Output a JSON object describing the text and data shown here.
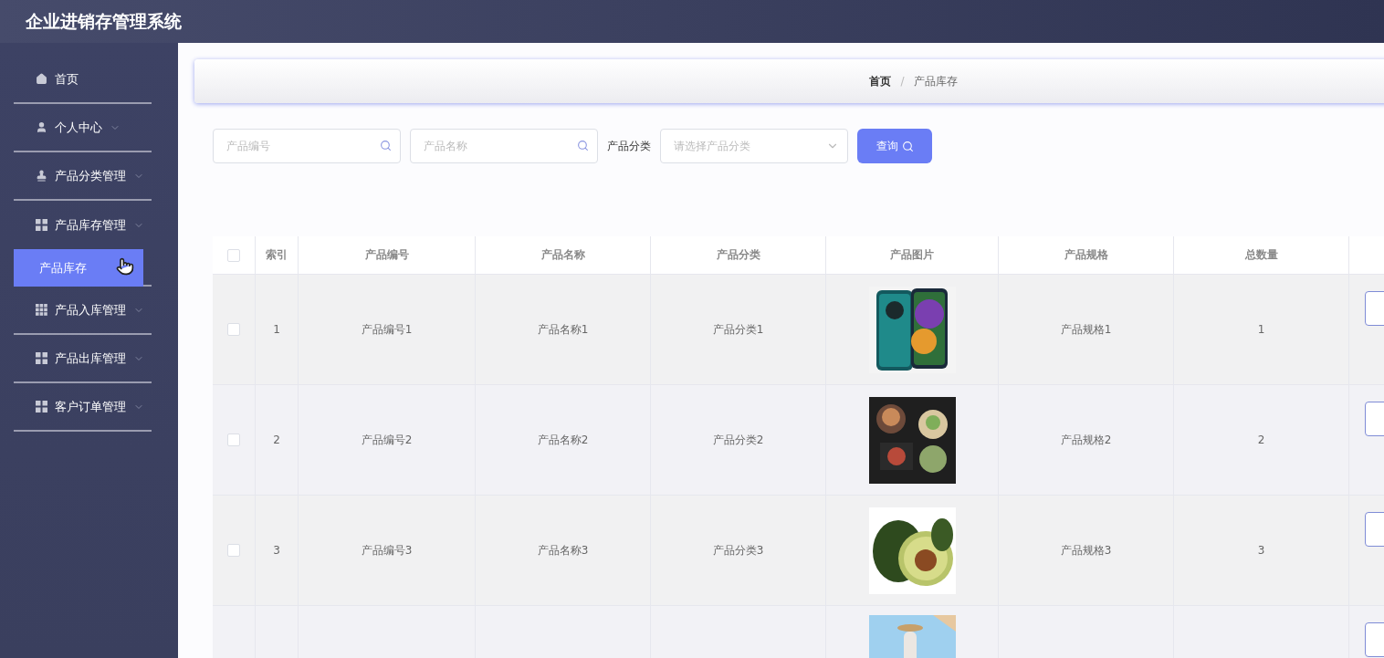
{
  "header": {
    "title": "企业进销存管理系统"
  },
  "sidebar": {
    "items": [
      {
        "kind": "link",
        "label": "首页"
      },
      {
        "kind": "menu",
        "label": "个人中心",
        "expanded": false
      },
      {
        "kind": "menu",
        "label": "产品分类管理",
        "expanded": false
      },
      {
        "kind": "menu",
        "label": "产品库存管理",
        "expanded": true,
        "children": [
          {
            "label": "产品库存",
            "selected": true
          }
        ]
      },
      {
        "kind": "menu",
        "label": "产品入库管理",
        "expanded": false
      },
      {
        "kind": "menu",
        "label": "产品出库管理",
        "expanded": false
      },
      {
        "kind": "menu",
        "label": "客户订单管理",
        "expanded": false
      }
    ]
  },
  "breadcrumb": {
    "items": [
      "首页",
      "产品库存"
    ],
    "separator": "/"
  },
  "search": {
    "code": {
      "placeholder": "产品编号"
    },
    "name": {
      "placeholder": "产品名称"
    },
    "category_label": "产品分类",
    "category": {
      "placeholder": "请选择产品分类"
    },
    "button": "查询"
  },
  "table": {
    "all_checked": false,
    "columns": [
      "索引",
      "产品编号",
      "产品名称",
      "产品分类",
      "产品图片",
      "产品规格",
      "总数量"
    ],
    "rows": [
      {
        "kind": "full",
        "checked": false,
        "index": "1",
        "code": "产品编号1",
        "name": "产品名称1",
        "category": "产品分类1",
        "spec": "产品规格1",
        "total": "1"
      },
      {
        "kind": "full",
        "checked": false,
        "index": "2",
        "code": "产品编号2",
        "name": "产品名称2",
        "category": "产品分类2",
        "spec": "产品规格2",
        "total": "2"
      },
      {
        "kind": "full",
        "checked": false,
        "index": "3",
        "code": "产品编号3",
        "name": "产品名称3",
        "category": "产品分类3",
        "spec": "产品规格3",
        "total": "3"
      },
      {
        "kind": "cut"
      }
    ]
  }
}
